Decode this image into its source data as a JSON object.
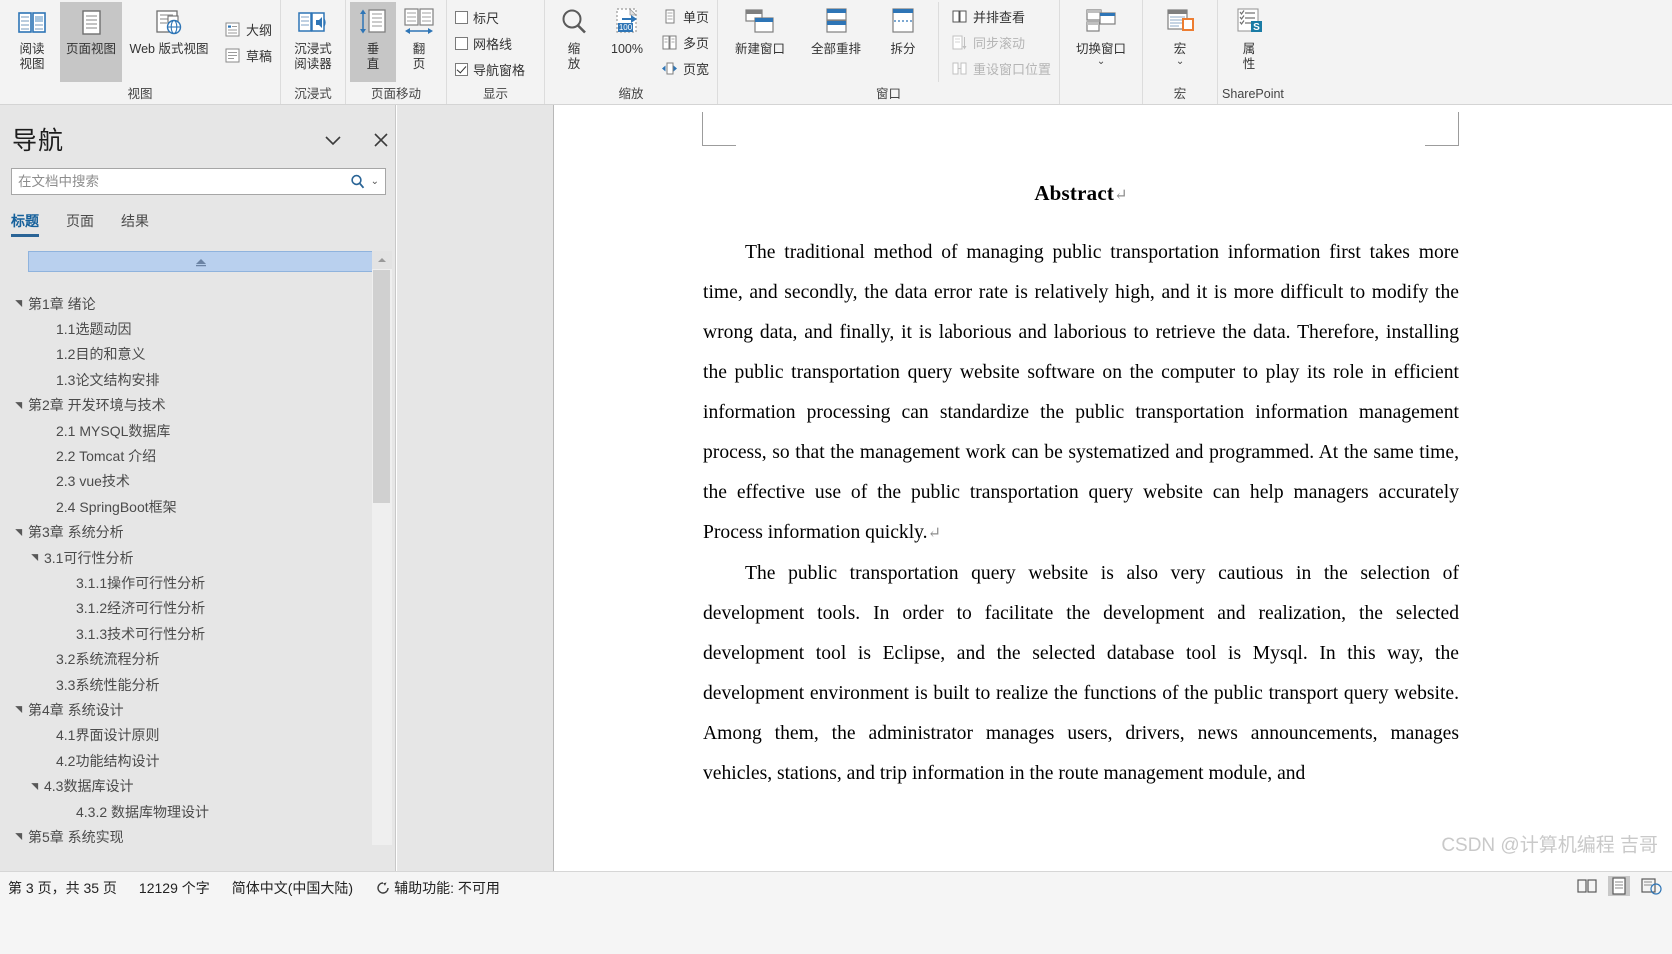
{
  "ribbon": {
    "groups": [
      {
        "label": "视图",
        "buttons": [
          {
            "name": "read-mode",
            "label": "阅读\n视图",
            "icon": "read-mode-icon",
            "selected": false
          },
          {
            "name": "print-layout",
            "label": "页面视图",
            "icon": "print-layout-icon",
            "selected": true
          },
          {
            "name": "web-layout",
            "label": "Web 版式视图",
            "icon": "web-layout-icon",
            "selected": false
          }
        ],
        "checks": [
          {
            "name": "outline",
            "label": "大纲",
            "icon": "outline-icon"
          },
          {
            "name": "draft",
            "label": "草稿",
            "icon": "draft-icon"
          }
        ]
      },
      {
        "label": "沉浸式",
        "buttons": [
          {
            "name": "immersive-reader",
            "label": "沉浸式\n阅读器",
            "icon": "immersive-reader-icon",
            "selected": false
          }
        ]
      },
      {
        "label": "页面移动",
        "buttons": [
          {
            "name": "vertical",
            "label": "垂\n直",
            "icon": "vertical-scroll-icon",
            "selected": true
          },
          {
            "name": "side-to-side",
            "label": "翻\n页",
            "icon": "side-to-side-icon",
            "selected": false
          }
        ]
      },
      {
        "label": "显示",
        "checkboxes": [
          {
            "name": "ruler",
            "label": "标尺",
            "checked": false
          },
          {
            "name": "gridlines",
            "label": "网格线",
            "checked": false
          },
          {
            "name": "navigation-pane",
            "label": "导航窗格",
            "checked": true
          }
        ]
      },
      {
        "label": "缩放",
        "buttons": [
          {
            "name": "zoom",
            "label": "缩\n放",
            "icon": "magnifier-icon",
            "selected": false
          },
          {
            "name": "zoom-100",
            "label": "100%",
            "icon": "zoom-100-icon",
            "selected": false
          }
        ],
        "rows": [
          {
            "name": "one-page",
            "label": "单页",
            "icon": "one-page-icon"
          },
          {
            "name": "multiple-pages",
            "label": "多页",
            "icon": "multiple-pages-icon"
          },
          {
            "name": "page-width",
            "label": "页宽",
            "icon": "page-width-icon"
          }
        ]
      },
      {
        "label": "窗口",
        "buttons": [
          {
            "name": "new-window",
            "label": "新建窗口",
            "icon": "new-window-icon",
            "selected": false
          },
          {
            "name": "arrange-all",
            "label": "全部重排",
            "icon": "arrange-all-icon",
            "selected": false
          },
          {
            "name": "split",
            "label": "拆分",
            "icon": "split-icon",
            "selected": false
          }
        ],
        "rows": [
          {
            "name": "view-side-by-side",
            "label": "并排查看",
            "icon": "side-by-side-icon",
            "disabled": false
          },
          {
            "name": "synchronous-scrolling",
            "label": "同步滚动",
            "icon": "sync-scroll-icon",
            "disabled": true
          },
          {
            "name": "reset-window-position",
            "label": "重设窗口位置",
            "icon": "reset-window-icon",
            "disabled": true
          }
        ]
      },
      {
        "label": "",
        "buttons": [
          {
            "name": "switch-windows",
            "label": "切换窗口",
            "icon": "switch-windows-icon",
            "dropdown": true,
            "selected": false
          }
        ]
      },
      {
        "label": "宏",
        "buttons": [
          {
            "name": "macros",
            "label": "宏",
            "icon": "macros-icon",
            "dropdown": true,
            "selected": false
          }
        ]
      },
      {
        "label": "SharePoint",
        "buttons": [
          {
            "name": "properties",
            "label": "属\n性",
            "icon": "properties-icon",
            "selected": false
          }
        ]
      }
    ]
  },
  "nav": {
    "title": "导航",
    "collapse_label": "▾",
    "close_label": "✕",
    "search": {
      "placeholder": "在文档中搜索",
      "value": ""
    },
    "search_icon": "search-icon",
    "search_dropdown": "▾",
    "tabs": [
      {
        "label": "标题",
        "active": true
      },
      {
        "label": "页面",
        "active": false
      },
      {
        "label": "结果",
        "active": false
      }
    ],
    "toc": [
      {
        "label": "第1章 绪论",
        "level": 1,
        "expandable": true
      },
      {
        "label": "1.1选题动因",
        "level": 2,
        "expandable": false
      },
      {
        "label": "1.2目的和意义",
        "level": 2,
        "expandable": false
      },
      {
        "label": "1.3论文结构安排",
        "level": 2,
        "expandable": false
      },
      {
        "label": "第2章 开发环境与技术",
        "level": 1,
        "expandable": true
      },
      {
        "label": "2.1 MYSQL数据库",
        "level": 2,
        "expandable": false
      },
      {
        "label": "2.2 Tomcat 介绍",
        "level": 2,
        "expandable": false
      },
      {
        "label": "2.3 vue技术",
        "level": 2,
        "expandable": false
      },
      {
        "label": "2.4 SpringBoot框架",
        "level": 2,
        "expandable": false
      },
      {
        "label": "第3章 系统分析",
        "level": 1,
        "expandable": true
      },
      {
        "label": "3.1可行性分析",
        "level": 2,
        "expandable": true
      },
      {
        "label": "3.1.1操作可行性分析",
        "level": 3,
        "expandable": false
      },
      {
        "label": "3.1.2经济可行性分析",
        "level": 3,
        "expandable": false
      },
      {
        "label": "3.1.3技术可行性分析",
        "level": 3,
        "expandable": false
      },
      {
        "label": "3.2系统流程分析",
        "level": 2,
        "expandable": false
      },
      {
        "label": "3.3系统性能分析",
        "level": 2,
        "expandable": false
      },
      {
        "label": "第4章 系统设计",
        "level": 1,
        "expandable": true
      },
      {
        "label": "4.1界面设计原则",
        "level": 2,
        "expandable": false
      },
      {
        "label": "4.2功能结构设计",
        "level": 2,
        "expandable": false
      },
      {
        "label": "4.3数据库设计",
        "level": 2,
        "expandable": true
      },
      {
        "label": "4.3.2 数据库物理设计",
        "level": 3,
        "expandable": false
      },
      {
        "label": "第5章 系统实现",
        "level": 1,
        "expandable": true
      }
    ]
  },
  "document": {
    "heading": "Abstract",
    "heading_mark": "↵",
    "paragraph1": "The traditional method of managing public transportation information first takes more time, and secondly, the data error rate is relatively high, and it is more difficult to modify the wrong data, and finally, it is laborious and laborious to retrieve the data. Therefore, installing the public transportation query website software on the computer to play its role in efficient information processing can standardize the public transportation information management process, so that the management work can be systematized and programmed. At the same time, the effective use of the public transportation query website can help managers accurately Process information quickly.",
    "paragraph1_mark": "↵",
    "paragraph2": "The public transportation query website is also very cautious in the selection of development tools. In order to facilitate the development and realization, the selected development tool is Eclipse, and the selected database tool is Mysql. In this way, the development environment is built to realize the functions of the public transport query website. Among them, the administrator manages users, drivers, news announcements, manages vehicles, stations, and trip information in the route management module, and",
    "watermark": "CSDN @计算机编程 吉哥"
  },
  "status": {
    "page": "第 3 页，共 35 页",
    "words": "12129 个字",
    "language": "简体中文(中国大陆)",
    "accessibility": "辅助功能: 不可用",
    "accessibility_icon": "accessibility-icon",
    "views": [
      {
        "name": "read-mode-view",
        "icon": "read-mode-view-icon",
        "selected": false
      },
      {
        "name": "print-layout-view",
        "icon": "print-layout-view-icon",
        "selected": true
      },
      {
        "name": "web-layout-view",
        "icon": "web-layout-view-icon",
        "selected": false
      }
    ]
  },
  "colors": {
    "accent": "#2a6496",
    "ribbon_bg": "#f3f3f3",
    "pane_bg": "#e6e6e6",
    "selected_tile": "#b9d0ee",
    "icon_blue": "#2e75b6",
    "icon_gray": "#7f7f7f"
  }
}
